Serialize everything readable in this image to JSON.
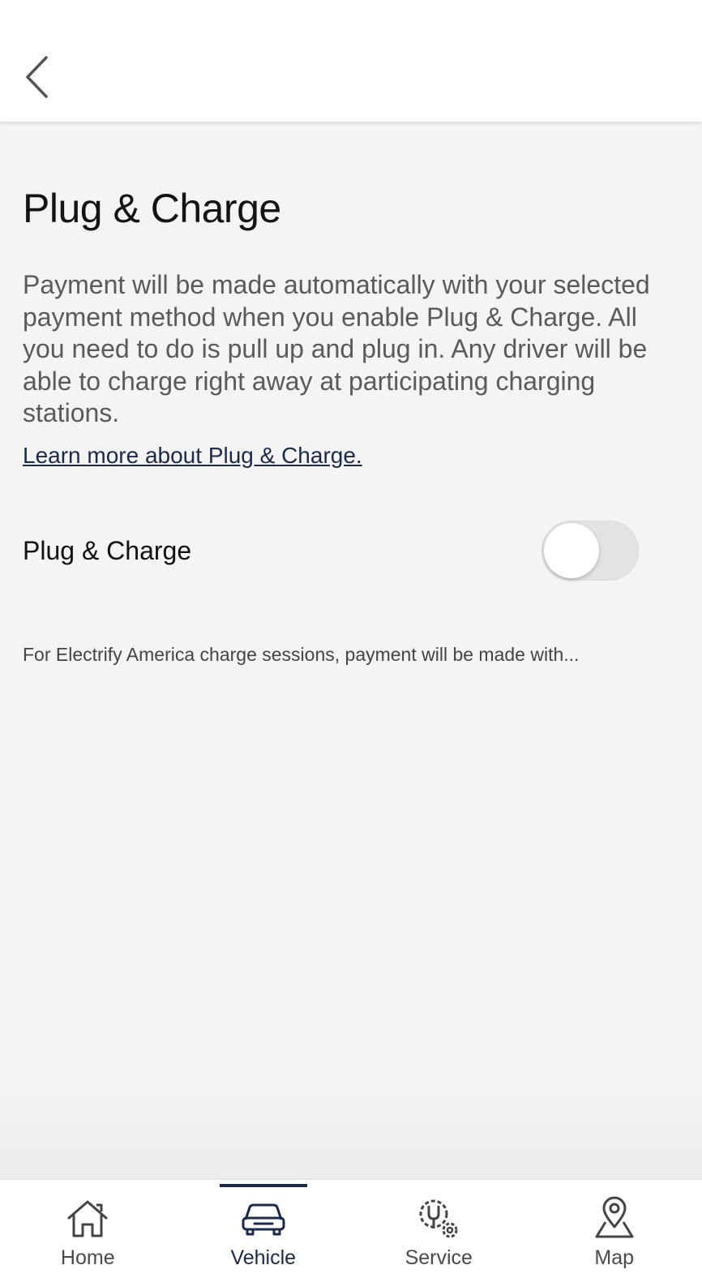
{
  "header": {
    "back_icon": "chevron-left-icon"
  },
  "page": {
    "title": "Plug & Charge",
    "description": "Payment will be made automatically with your selected payment method when you enable Plug & Charge. All you need to do is pull up and plug in. Any driver will be able to charge right away at participating charging stations.",
    "learn_more_link": "Learn more about Plug & Charge.",
    "toggle_label": "Plug & Charge",
    "toggle_on": false,
    "footnote": "For Electrify America charge sessions, payment will be made with..."
  },
  "tabbar": {
    "tabs": [
      {
        "label": "Home",
        "icon": "home-icon",
        "active": false
      },
      {
        "label": "Vehicle",
        "icon": "car-icon",
        "active": true
      },
      {
        "label": "Service",
        "icon": "service-icon",
        "active": false
      },
      {
        "label": "Map",
        "icon": "map-pin-icon",
        "active": false
      }
    ]
  },
  "colors": {
    "accent": "#1b2a4a",
    "background": "#f4f4f4",
    "toggle_off": "#e3e3e3"
  }
}
